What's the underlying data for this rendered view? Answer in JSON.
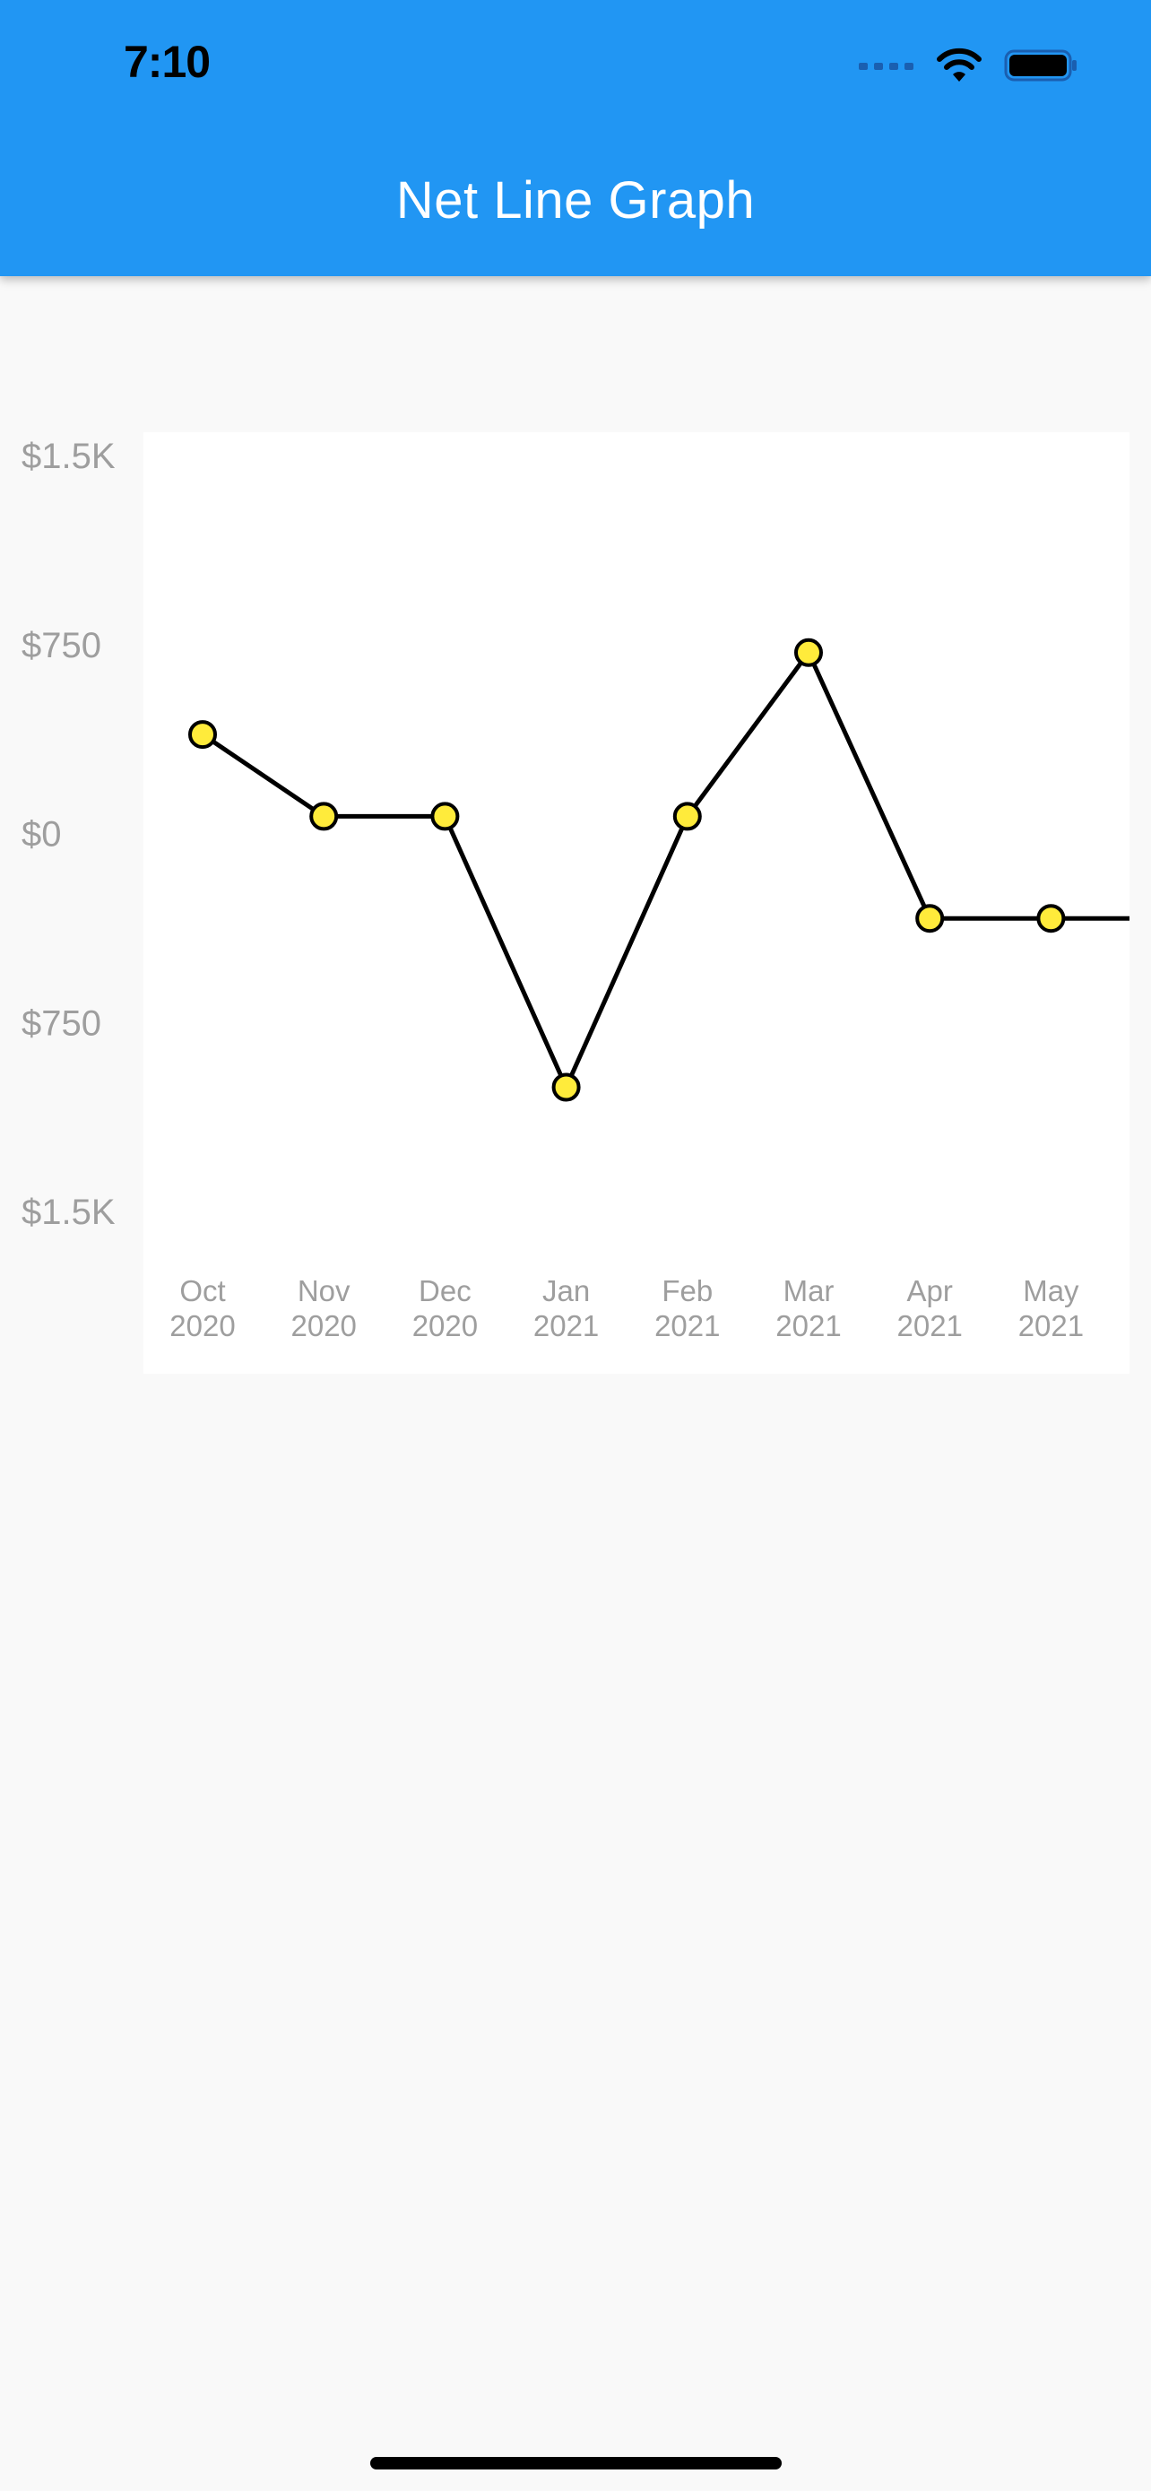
{
  "status_bar": {
    "time": "7:10",
    "icons": [
      "cellular-signal-icon",
      "wifi-icon",
      "battery-icon"
    ]
  },
  "app_bar": {
    "title": "Net Line Graph",
    "background_color": "#2196f3"
  },
  "chart_data": {
    "type": "line",
    "title": "",
    "xlabel": "",
    "ylabel": "",
    "categories": [
      [
        "Oct",
        "2020"
      ],
      [
        "Nov",
        "2020"
      ],
      [
        "Dec",
        "2020"
      ],
      [
        "Jan",
        "2021"
      ],
      [
        "Feb",
        "2021"
      ],
      [
        "Mar",
        "2021"
      ],
      [
        "Apr",
        "2021"
      ],
      [
        "May",
        "2021"
      ]
    ],
    "series": [
      {
        "values": [
          400,
          75,
          75,
          -1000,
          75,
          725,
          -330,
          -330
        ],
        "line_color": "#000000",
        "marker_fill": "#ffeb3b",
        "marker_stroke": "#000000"
      }
    ],
    "ylim": [
      -1500,
      1500
    ],
    "y_ticks": [
      {
        "value": 1500,
        "label": "$1.5K"
      },
      {
        "value": 750,
        "label": "$750"
      },
      {
        "value": 0,
        "label": "$0"
      },
      {
        "value": -750,
        "label": "$750"
      },
      {
        "value": -1500,
        "label": "$1.5K"
      }
    ],
    "grid": false,
    "legend": "none"
  }
}
